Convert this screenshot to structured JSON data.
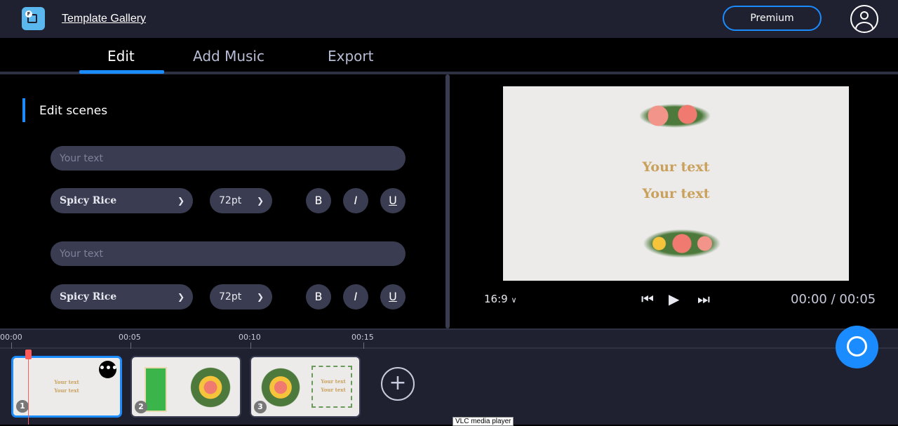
{
  "header": {
    "logo_icon": "video-camera-app-icon",
    "gallery_link": "Template Gallery",
    "premium_label": "Premium",
    "user_icon": "user-circle-icon"
  },
  "tabs": [
    {
      "label": "Edit",
      "active": true
    },
    {
      "label": "Add Music"
    },
    {
      "label": "Export"
    }
  ],
  "editor": {
    "section_title": "Edit scenes",
    "fields": [
      {
        "placeholder": "Your text",
        "value": "",
        "font": "Spicy Rice",
        "size": "72pt",
        "bold": "B",
        "italic": "I",
        "underline": "U"
      },
      {
        "placeholder": "Your text",
        "value": "",
        "font": "Spicy Rice",
        "size": "72pt",
        "bold": "B",
        "italic": "I",
        "underline": "U"
      }
    ]
  },
  "preview": {
    "line1": "Your text",
    "line2": "Your text",
    "aspect_ratio": "16:9",
    "time": "00:00 / 00:05"
  },
  "timeline": {
    "ticks": [
      "00:00",
      "00:05",
      "00:10",
      "00:15"
    ],
    "scenes": [
      {
        "number": "1",
        "text1": "Your text",
        "text2": "Your text",
        "selected": true
      },
      {
        "number": "2"
      },
      {
        "number": "3",
        "text1": "Your text",
        "text2": "Your text"
      }
    ]
  },
  "colors": {
    "accent": "#1a8cff",
    "playhead": "#ff5a5a",
    "text_gold": "#c9a15d"
  },
  "tooltip": "VLC media player"
}
